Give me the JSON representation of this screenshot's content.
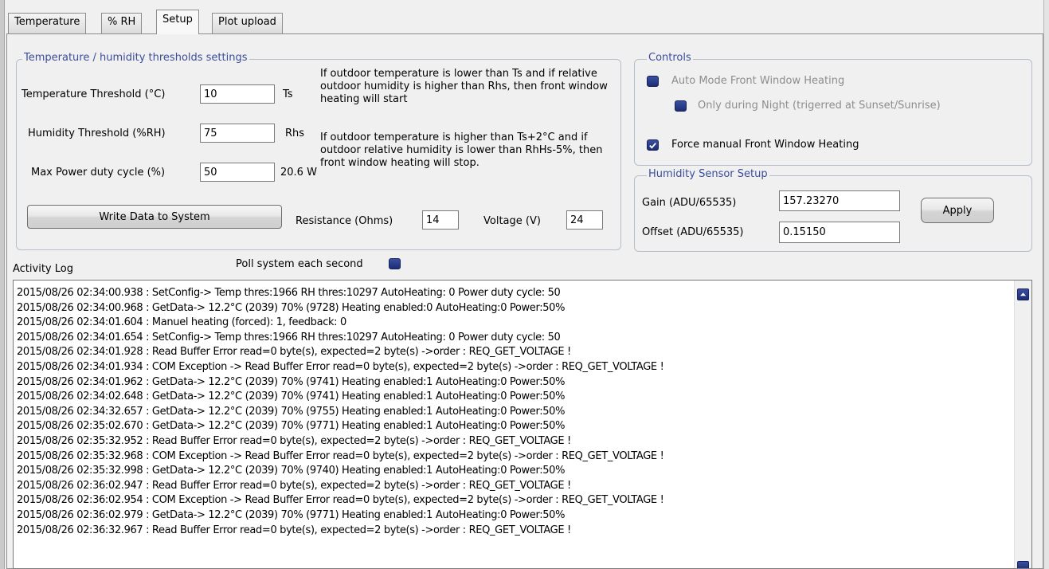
{
  "tabs": [
    {
      "label": "Temperature"
    },
    {
      "label": "% RH"
    },
    {
      "label": "Setup"
    },
    {
      "label": "Plot upload"
    }
  ],
  "active_tab": "Setup",
  "thresholds": {
    "title": "Temperature / humidity thresholds settings",
    "temperature_label": "Temperature Threshold (°C)",
    "temperature_value": "10",
    "temperature_unit": "Ts",
    "humidity_label": "Humidity Threshold (%RH)",
    "humidity_value": "75",
    "humidity_unit": "Rhs",
    "power_label": "Max Power duty cycle (%)",
    "power_value": "50",
    "power_watts": "20.6 W",
    "note_start": "If outdoor temperature is lower than Ts and if relative outdoor humidity is higher than Rhs, then front window heating will start",
    "note_stop": "If outdoor temperature is higher than Ts+2°C and if outdoor relative humidity is lower than RhHs-5%, then front window heating will stop.",
    "write_button": "Write Data to System",
    "resistance_label": "Resistance (Ohms)",
    "resistance_value": "14",
    "voltage_label": "Voltage (V)",
    "voltage_value": "24"
  },
  "controls": {
    "title": "Controls",
    "auto_mode_label": "Auto Mode Front Window Heating",
    "auto_mode_checked": false,
    "night_only_label": "Only during Night (trigerred at Sunset/Sunrise)",
    "night_only_checked": false,
    "force_manual_label": "Force manual Front Window Heating",
    "force_manual_checked": true
  },
  "humidity_sensor": {
    "title": "Humidity Sensor Setup",
    "gain_label": "Gain (ADU/65535)",
    "gain_value": "157.23270",
    "offset_label": "Offset (ADU/65535)",
    "offset_value": "0.15150",
    "apply_button": "Apply"
  },
  "activity_log": {
    "label": "Activity Log",
    "poll_label": "Poll system each second",
    "poll_checked": false,
    "lines": [
      "2015/08/26  02:34:00.938 : SetConfig-> Temp thres:1966 RH thres:10297 AutoHeating: 0 Power duty cycle: 50",
      "2015/08/26  02:34:00.968 : GetData-> 12.2°C (2039) 70% (9728) Heating enabled:0 AutoHeating:0 Power:50%",
      "2015/08/26  02:34:01.604 : Manuel heating (forced): 1, feedback: 0",
      "2015/08/26  02:34:01.654 : SetConfig-> Temp thres:1966 RH thres:10297 AutoHeating: 0 Power duty cycle: 50",
      "2015/08/26  02:34:01.928 : Read Buffer Error read=0 byte(s), expected=2 byte(s) ->order : REQ_GET_VOLTAGE !",
      "2015/08/26  02:34:01.934 : COM Exception -> Read Buffer Error read=0 byte(s), expected=2 byte(s) ->order : REQ_GET_VOLTAGE !",
      "2015/08/26  02:34:01.962 : GetData-> 12.2°C (2039) 70% (9741) Heating enabled:1 AutoHeating:0 Power:50%",
      "2015/08/26  02:34:02.648 : GetData-> 12.2°C (2039) 70% (9741) Heating enabled:1 AutoHeating:0 Power:50%",
      "2015/08/26  02:34:32.657 : GetData-> 12.2°C (2039) 70% (9755) Heating enabled:1 AutoHeating:0 Power:50%",
      "2015/08/26  02:35:02.670 : GetData-> 12.2°C (2039) 70% (9771) Heating enabled:1 AutoHeating:0 Power:50%",
      "2015/08/26  02:35:32.952 : Read Buffer Error read=0 byte(s), expected=2 byte(s) ->order : REQ_GET_VOLTAGE !",
      "2015/08/26  02:35:32.968 : COM Exception -> Read Buffer Error read=0 byte(s), expected=2 byte(s) ->order : REQ_GET_VOLTAGE !",
      "2015/08/26  02:35:32.998 : GetData-> 12.2°C (2039) 70% (9740) Heating enabled:1 AutoHeating:0 Power:50%",
      "2015/08/26  02:36:02.947 : Read Buffer Error read=0 byte(s), expected=2 byte(s) ->order : REQ_GET_VOLTAGE !",
      "2015/08/26  02:36:02.954 : COM Exception -> Read Buffer Error read=0 byte(s), expected=2 byte(s) ->order : REQ_GET_VOLTAGE !",
      "2015/08/26  02:36:02.979 : GetData-> 12.2°C (2039) 70% (9771) Heating enabled:1 AutoHeating:0 Power:50%",
      "2015/08/26  02:36:32.967 : Read Buffer Error read=0 byte(s), expected=2 byte(s) ->order : REQ_GET_VOLTAGE !"
    ]
  },
  "colors": {
    "group_title": "#3a4d9a",
    "checkbox_fill": "#1d2d75",
    "disabled_text": "#8d8d8d"
  },
  "icons": {
    "checkmark": "check-icon",
    "scroll_up": "arrow-up-icon"
  }
}
